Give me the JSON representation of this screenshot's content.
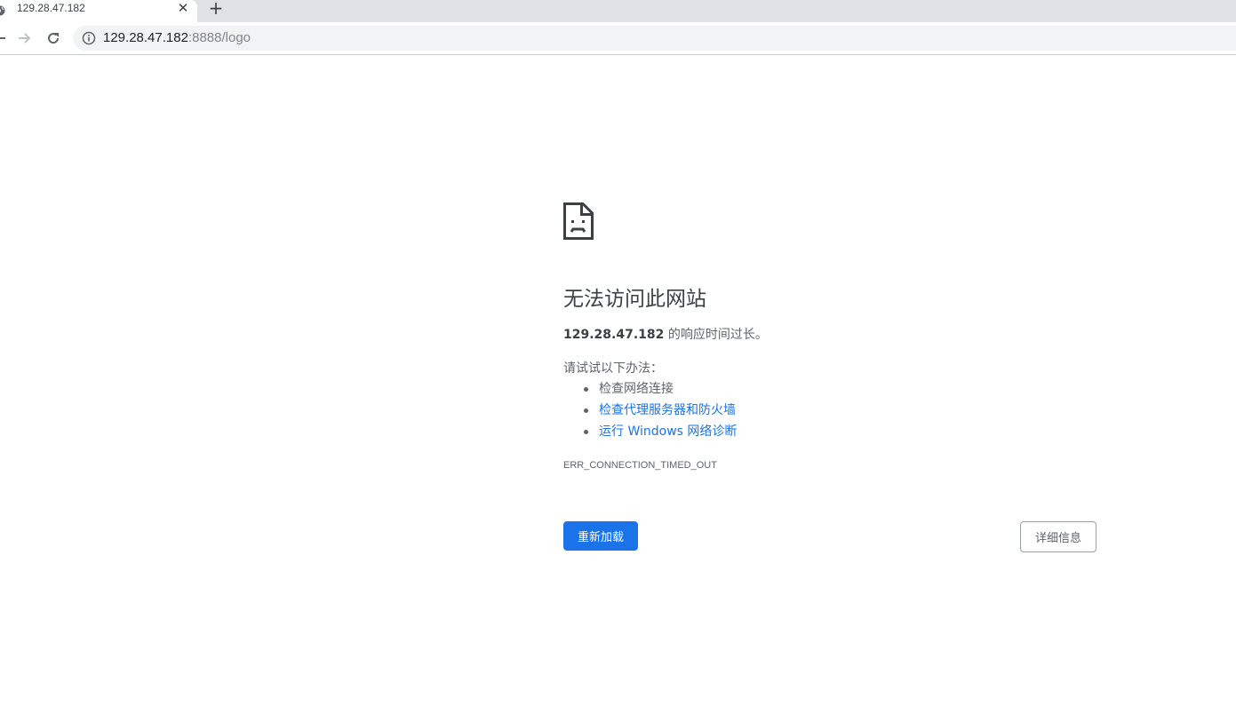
{
  "browser": {
    "tab": {
      "title": "129.28.47.182",
      "close_icon": "close-icon",
      "favicon": "globe-icon"
    },
    "new_tab_icon": "plus-icon",
    "toolbar": {
      "back_icon": "arrow-left-icon",
      "forward_icon": "arrow-right-icon",
      "reload_icon": "reload-icon",
      "site_info_icon": "info-icon"
    },
    "address": {
      "host": "129.28.47.182",
      "rest": ":8888/logo"
    }
  },
  "error_page": {
    "icon": "sad-document-icon",
    "heading": "无法访问此网站",
    "host": "129.28.47.182",
    "description_suffix": " 的响应时间过长。",
    "try_label": "请试试以下办法：",
    "suggestions": [
      {
        "text": "检查网络连接",
        "link": false
      },
      {
        "text": "检查代理服务器和防火墙",
        "link": true
      },
      {
        "text": "运行 Windows 网络诊断",
        "link": true
      }
    ],
    "error_code": "ERR_CONNECTION_TIMED_OUT",
    "reload_button": "重新加载",
    "details_button": "详细信息"
  },
  "colors": {
    "accent": "#1a73e8",
    "tabstrip": "#dee1e6",
    "omnibox": "#f1f3f4",
    "text_secondary": "#5f6368"
  }
}
